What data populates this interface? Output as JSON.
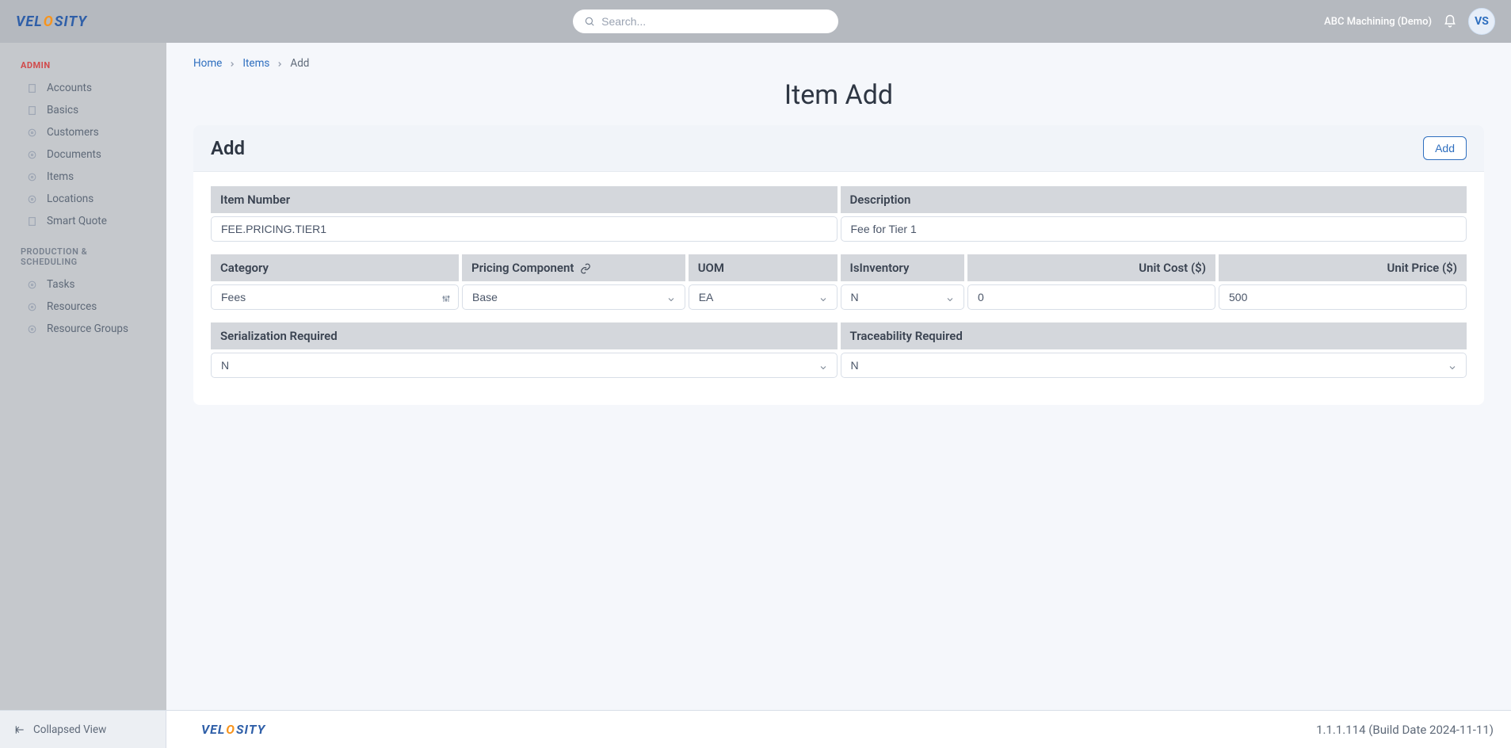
{
  "header": {
    "search_placeholder": "Search...",
    "org_name": "ABC Machining (Demo)",
    "avatar_initials": "VS"
  },
  "logo": {
    "part1": "VEL",
    "part2": "O",
    "part3": "SITY"
  },
  "sidebar": {
    "section_admin": "ADMIN",
    "admin_items": [
      {
        "label": "Accounts"
      },
      {
        "label": "Basics"
      },
      {
        "label": "Customers"
      },
      {
        "label": "Documents"
      },
      {
        "label": "Items"
      },
      {
        "label": "Locations"
      },
      {
        "label": "Smart Quote"
      }
    ],
    "section_prod": "PRODUCTION & SCHEDULING",
    "prod_items": [
      {
        "label": "Tasks"
      },
      {
        "label": "Resources"
      },
      {
        "label": "Resource Groups"
      }
    ],
    "collapsed_view": "Collapsed View"
  },
  "breadcrumb": {
    "home": "Home",
    "items": "Items",
    "current": "Add"
  },
  "page": {
    "title": "Item Add",
    "card_title": "Add",
    "add_button": "Add"
  },
  "form": {
    "row1": {
      "item_number": {
        "label": "Item Number",
        "value": "FEE.PRICING.TIER1"
      },
      "description": {
        "label": "Description",
        "value": "Fee for Tier 1"
      }
    },
    "row2": {
      "category": {
        "label": "Category",
        "value": "Fees"
      },
      "pricing_component": {
        "label": "Pricing Component",
        "value": "Base"
      },
      "uom": {
        "label": "UOM",
        "value": "EA"
      },
      "is_inventory": {
        "label": "IsInventory",
        "value": "N"
      },
      "unit_cost": {
        "label": "Unit Cost ($)",
        "value": "0"
      },
      "unit_price": {
        "label": "Unit Price ($)",
        "value": "500"
      }
    },
    "row3": {
      "serialization": {
        "label": "Serialization Required",
        "value": "N"
      },
      "traceability": {
        "label": "Traceability Required",
        "value": "N"
      }
    }
  },
  "footer": {
    "version": "1.1.1.114 (Build Date 2024-11-11)"
  }
}
